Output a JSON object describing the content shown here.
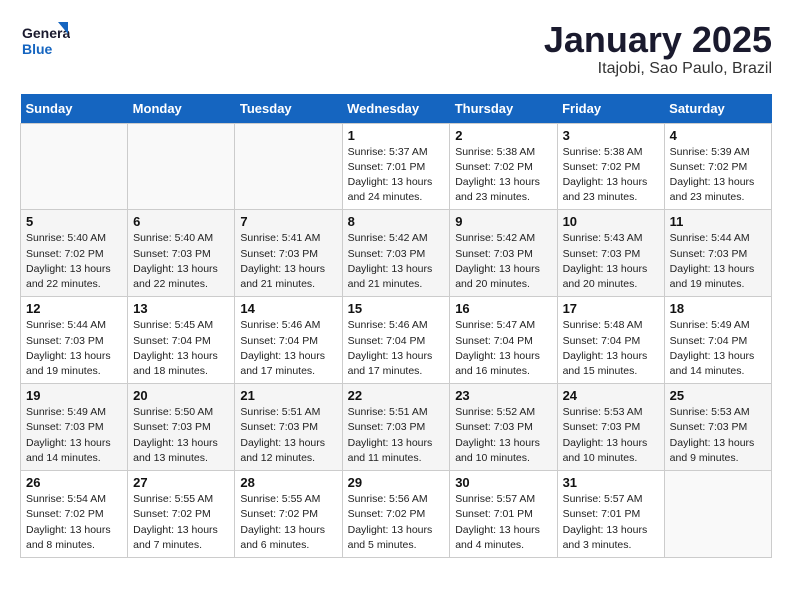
{
  "header": {
    "logo_line1": "General",
    "logo_line2": "Blue",
    "title": "January 2025",
    "subtitle": "Itajobi, Sao Paulo, Brazil"
  },
  "weekdays": [
    "Sunday",
    "Monday",
    "Tuesday",
    "Wednesday",
    "Thursday",
    "Friday",
    "Saturday"
  ],
  "weeks": [
    [
      {
        "day": "",
        "info": ""
      },
      {
        "day": "",
        "info": ""
      },
      {
        "day": "",
        "info": ""
      },
      {
        "day": "1",
        "info": "Sunrise: 5:37 AM\nSunset: 7:01 PM\nDaylight: 13 hours\nand 24 minutes."
      },
      {
        "day": "2",
        "info": "Sunrise: 5:38 AM\nSunset: 7:02 PM\nDaylight: 13 hours\nand 23 minutes."
      },
      {
        "day": "3",
        "info": "Sunrise: 5:38 AM\nSunset: 7:02 PM\nDaylight: 13 hours\nand 23 minutes."
      },
      {
        "day": "4",
        "info": "Sunrise: 5:39 AM\nSunset: 7:02 PM\nDaylight: 13 hours\nand 23 minutes."
      }
    ],
    [
      {
        "day": "5",
        "info": "Sunrise: 5:40 AM\nSunset: 7:02 PM\nDaylight: 13 hours\nand 22 minutes."
      },
      {
        "day": "6",
        "info": "Sunrise: 5:40 AM\nSunset: 7:03 PM\nDaylight: 13 hours\nand 22 minutes."
      },
      {
        "day": "7",
        "info": "Sunrise: 5:41 AM\nSunset: 7:03 PM\nDaylight: 13 hours\nand 21 minutes."
      },
      {
        "day": "8",
        "info": "Sunrise: 5:42 AM\nSunset: 7:03 PM\nDaylight: 13 hours\nand 21 minutes."
      },
      {
        "day": "9",
        "info": "Sunrise: 5:42 AM\nSunset: 7:03 PM\nDaylight: 13 hours\nand 20 minutes."
      },
      {
        "day": "10",
        "info": "Sunrise: 5:43 AM\nSunset: 7:03 PM\nDaylight: 13 hours\nand 20 minutes."
      },
      {
        "day": "11",
        "info": "Sunrise: 5:44 AM\nSunset: 7:03 PM\nDaylight: 13 hours\nand 19 minutes."
      }
    ],
    [
      {
        "day": "12",
        "info": "Sunrise: 5:44 AM\nSunset: 7:03 PM\nDaylight: 13 hours\nand 19 minutes."
      },
      {
        "day": "13",
        "info": "Sunrise: 5:45 AM\nSunset: 7:04 PM\nDaylight: 13 hours\nand 18 minutes."
      },
      {
        "day": "14",
        "info": "Sunrise: 5:46 AM\nSunset: 7:04 PM\nDaylight: 13 hours\nand 17 minutes."
      },
      {
        "day": "15",
        "info": "Sunrise: 5:46 AM\nSunset: 7:04 PM\nDaylight: 13 hours\nand 17 minutes."
      },
      {
        "day": "16",
        "info": "Sunrise: 5:47 AM\nSunset: 7:04 PM\nDaylight: 13 hours\nand 16 minutes."
      },
      {
        "day": "17",
        "info": "Sunrise: 5:48 AM\nSunset: 7:04 PM\nDaylight: 13 hours\nand 15 minutes."
      },
      {
        "day": "18",
        "info": "Sunrise: 5:49 AM\nSunset: 7:04 PM\nDaylight: 13 hours\nand 14 minutes."
      }
    ],
    [
      {
        "day": "19",
        "info": "Sunrise: 5:49 AM\nSunset: 7:03 PM\nDaylight: 13 hours\nand 14 minutes."
      },
      {
        "day": "20",
        "info": "Sunrise: 5:50 AM\nSunset: 7:03 PM\nDaylight: 13 hours\nand 13 minutes."
      },
      {
        "day": "21",
        "info": "Sunrise: 5:51 AM\nSunset: 7:03 PM\nDaylight: 13 hours\nand 12 minutes."
      },
      {
        "day": "22",
        "info": "Sunrise: 5:51 AM\nSunset: 7:03 PM\nDaylight: 13 hours\nand 11 minutes."
      },
      {
        "day": "23",
        "info": "Sunrise: 5:52 AM\nSunset: 7:03 PM\nDaylight: 13 hours\nand 10 minutes."
      },
      {
        "day": "24",
        "info": "Sunrise: 5:53 AM\nSunset: 7:03 PM\nDaylight: 13 hours\nand 10 minutes."
      },
      {
        "day": "25",
        "info": "Sunrise: 5:53 AM\nSunset: 7:03 PM\nDaylight: 13 hours\nand 9 minutes."
      }
    ],
    [
      {
        "day": "26",
        "info": "Sunrise: 5:54 AM\nSunset: 7:02 PM\nDaylight: 13 hours\nand 8 minutes."
      },
      {
        "day": "27",
        "info": "Sunrise: 5:55 AM\nSunset: 7:02 PM\nDaylight: 13 hours\nand 7 minutes."
      },
      {
        "day": "28",
        "info": "Sunrise: 5:55 AM\nSunset: 7:02 PM\nDaylight: 13 hours\nand 6 minutes."
      },
      {
        "day": "29",
        "info": "Sunrise: 5:56 AM\nSunset: 7:02 PM\nDaylight: 13 hours\nand 5 minutes."
      },
      {
        "day": "30",
        "info": "Sunrise: 5:57 AM\nSunset: 7:01 PM\nDaylight: 13 hours\nand 4 minutes."
      },
      {
        "day": "31",
        "info": "Sunrise: 5:57 AM\nSunset: 7:01 PM\nDaylight: 13 hours\nand 3 minutes."
      },
      {
        "day": "",
        "info": ""
      }
    ]
  ]
}
